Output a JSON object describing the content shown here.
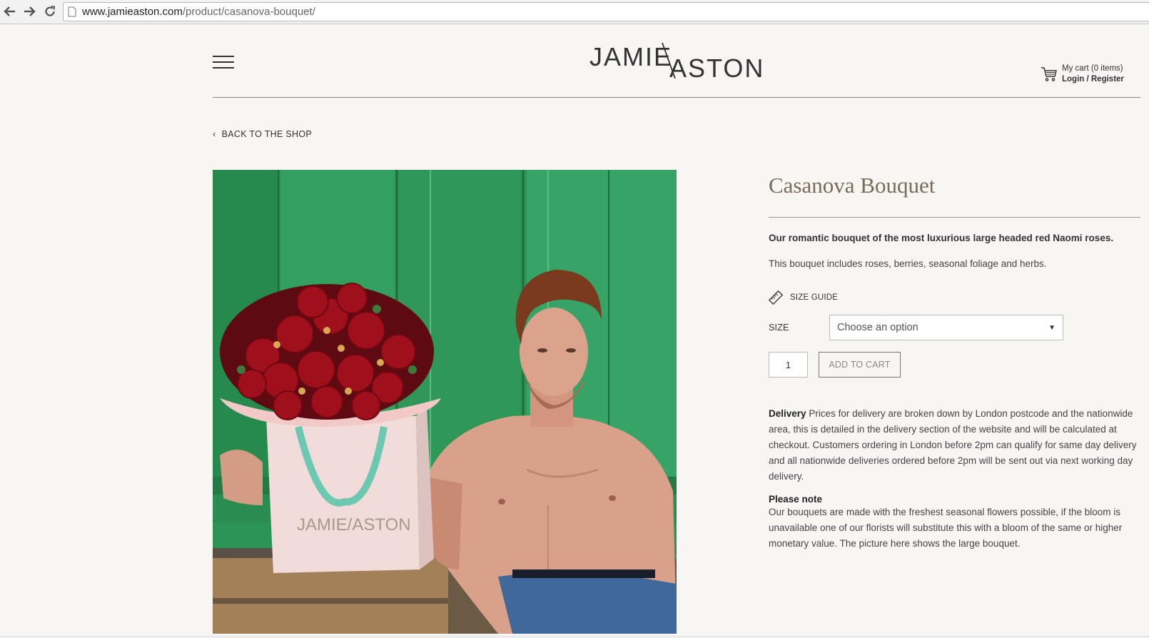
{
  "browser": {
    "url_host": "www.jamieaston.com",
    "url_path": "/product/casanova-bouquet/",
    "back_icon": "back-arrow-icon",
    "forward_icon": "forward-arrow-icon",
    "reload_icon": "reload-icon"
  },
  "header": {
    "logo_text_left": "JAMIE",
    "logo_text_right": "ASTON",
    "menu_icon": "hamburger-icon",
    "cart_label": "My cart (0 items)",
    "login_label": "Login / Register"
  },
  "back_link": "BACK TO THE SHOP",
  "product": {
    "title": "Casanova Bouquet",
    "intro_bold": "Our romantic bouquet of the most luxurious large headed red Naomi roses.",
    "intro": "This bouquet includes roses, berries, seasonal foliage and herbs.",
    "size_guide_label": "SIZE GUIDE",
    "size_label": "SIZE",
    "size_placeholder": "Choose an option",
    "quantity": "1",
    "add_to_cart": "ADD TO CART",
    "delivery_title": "Delivery",
    "delivery_text": "Prices for delivery are broken down by London postcode and the nationwide area, this is detailed in the delivery section of the website and will be calculated at checkout. Customers ordering in London before 2pm can qualify for same day delivery and all nationwide deliveries ordered before 2pm will be sent out via next working day delivery.",
    "note_title": "Please note",
    "note_text": "Our bouquets are made with the freshest seasonal flowers possible, if the bloom is unavailable one of our florists will substitute this with a bloom of the same or higher monetary value. The picture here shows the large bouquet.",
    "image_bag_text": "JAMIE/ASTON"
  },
  "colors": {
    "background": "#f8f6f2",
    "title": "#7a6a5a",
    "photo_wall": "#2f9a5b",
    "bag": "#f1dcd9",
    "ribbon": "#6cc8b0",
    "roses": "#a0101c"
  }
}
